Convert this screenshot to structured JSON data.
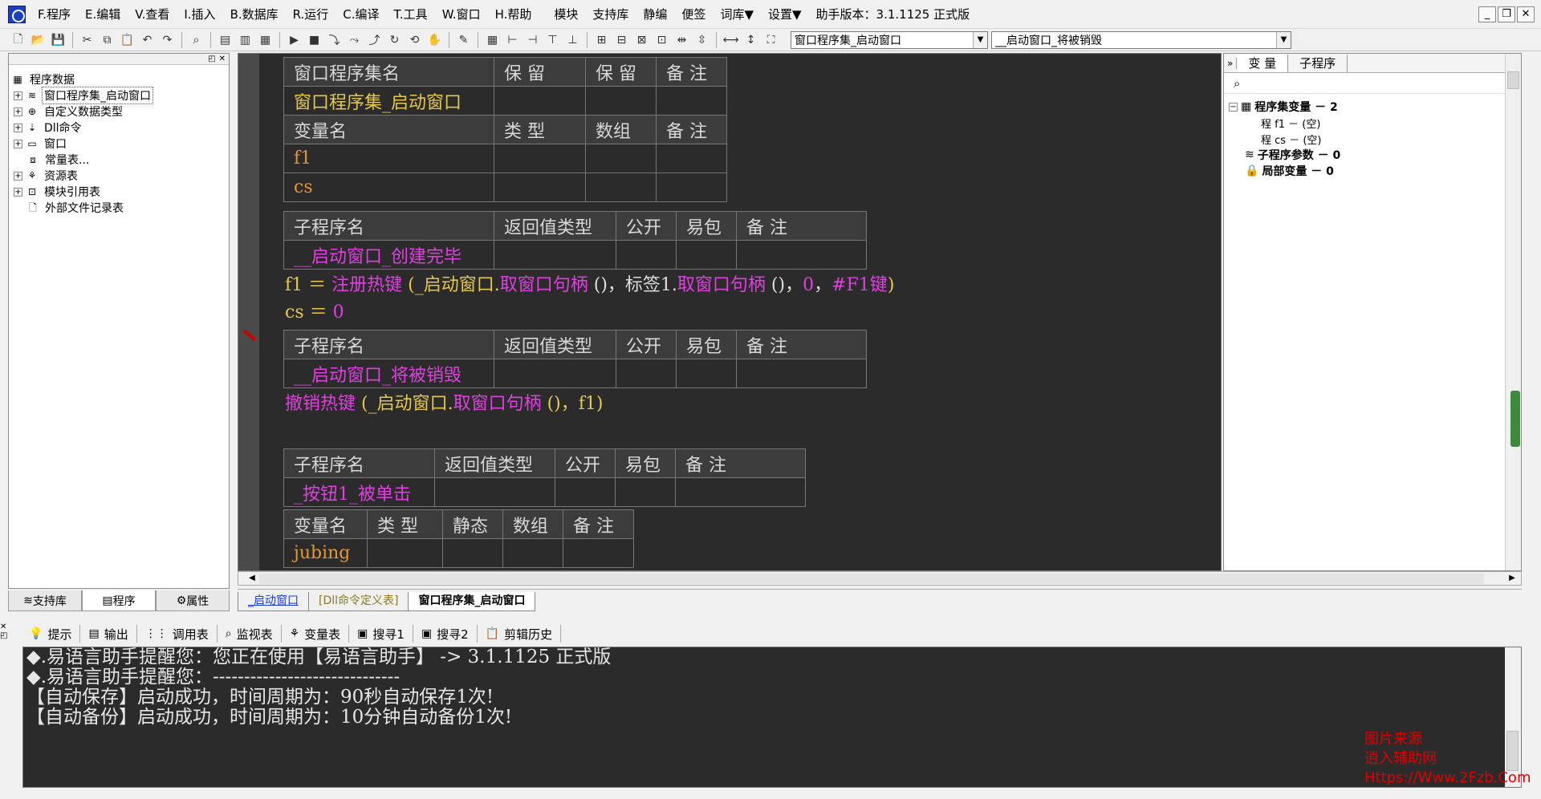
{
  "menu": {
    "items": [
      "F.程序",
      "E.编辑",
      "V.查看",
      "I.插入",
      "B.数据库",
      "R.运行",
      "C.编译",
      "T.工具",
      "W.窗口",
      "H.帮助",
      "模块",
      "支持库",
      "静编",
      "便签",
      "词库▼",
      "设置▼",
      "助手版本：3.1.1125 正式版"
    ]
  },
  "toolbar": {
    "combo1": "窗口程序集_启动窗口",
    "combo2": "__启动窗口_将被销毁"
  },
  "tree": {
    "root": "程序数据",
    "items": [
      "窗口程序集_启动窗口",
      "自定义数据类型",
      "Dll命令",
      "窗口",
      "常量表...",
      "资源表",
      "模块引用表",
      "外部文件记录表"
    ]
  },
  "left_tabs": [
    "支持库",
    "程序",
    "属性"
  ],
  "editor": {
    "t1": {
      "headers": [
        "窗口程序集名",
        "保 留",
        "保 留",
        "备 注"
      ],
      "name": "窗口程序集_启动窗口"
    },
    "t2": {
      "headers": [
        "变量名",
        "类 型",
        "数组",
        "备 注"
      ],
      "vars": [
        "f1",
        "cs"
      ]
    },
    "t3": {
      "headers": [
        "子程序名",
        "返回值类型",
        "公开",
        "易包",
        "备 注"
      ],
      "name": "__启动窗口_创建完毕"
    },
    "line1": {
      "a": "f1 ＝ ",
      "b": "注册热键",
      "c": " (_启动窗口.",
      "d": "取窗口句柄",
      "e": " ()，标签1.",
      "f": "取窗口句柄",
      "g": " ()，",
      "h": "0",
      "i": "，",
      "j": "#F1键",
      "k": ")"
    },
    "line2": {
      "a": "cs ＝ ",
      "b": "0"
    },
    "t4": {
      "headers": [
        "子程序名",
        "返回值类型",
        "公开",
        "易包",
        "备 注"
      ],
      "name": "__启动窗口_将被销毁"
    },
    "line3": {
      "a": "撤销热键",
      "b": " (_启动窗口.",
      "c": "取窗口句柄",
      "d": " ()，f1)"
    },
    "t5": {
      "headers": [
        "子程序名",
        "返回值类型",
        "公开",
        "易包",
        "备 注"
      ],
      "name": "_按钮1_被单击"
    },
    "t6": {
      "headers": [
        "变量名",
        "类 型",
        "静态",
        "数组",
        "备 注"
      ],
      "var": "jubing"
    }
  },
  "doc_tabs": [
    "_启动窗口",
    "[Dll命令定义表]",
    "窗口程序集_启动窗口"
  ],
  "right_panel": {
    "tabs": [
      "变 量",
      "子程序"
    ],
    "items": {
      "a": "程序集变量 － 2",
      "b": "程 f1 － (空)",
      "c": "程 cs － (空)",
      "d": "子程序参数 － 0",
      "e": "局部变量 － 0"
    }
  },
  "bottom_tabs": [
    "提示",
    "输出",
    "调用表",
    "监视表",
    "变量表",
    "搜寻1",
    "搜寻2",
    "剪辑历史"
  ],
  "output": [
    "◆.易语言助手提醒您：您正在使用【易语言助手】 -> 3.1.1125 正式版",
    "◆.易语言助手提醒您：------------------------------",
    "【自动保存】启动成功，时间周期为：90秒自动保存1次!",
    "【自动备份】启动成功，时间周期为：10分钟自动备份1次!"
  ],
  "watermark": {
    "l1": "图片来源",
    "l2": "逍入辅助网",
    "l3": "Https://Www.2Fzb.Com"
  },
  "colors": {
    "editor_bg": "#2b2b2b",
    "keyword": "#e040e0",
    "identifier": "#e6c84a",
    "variable": "#e8952e"
  }
}
